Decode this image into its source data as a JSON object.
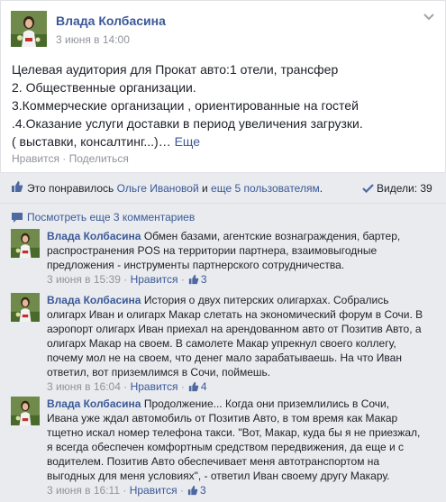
{
  "post": {
    "author": "Влада Колбасина",
    "date": "3 июня в 14:00",
    "body_lines": [
      "Целевая аудитория для Прокат авто:1 отели, трансфер",
      "2. Общественные организации.",
      "3.Коммерческие организации , ориентированные на гостей",
      ".4.Оказание услуги доставки в период увеличения загрузки.",
      "( выставки, консалтинг...)…"
    ],
    "more_label": "Еще",
    "actions": {
      "like": "Нравится",
      "dot": " · ",
      "share": "Поделиться"
    }
  },
  "likes": {
    "prefix": "Это понравилось ",
    "user": "Ольге Ивановой",
    "and": " и ",
    "others": "еще 5 пользователям",
    "suffix": ".",
    "seen": "Видели: 39"
  },
  "view_more": "Посмотреть еще 3 комментариев",
  "comments": [
    {
      "author": "Влада Колбасина",
      "lines": [
        "Обмен базами, агентские вознаграждения, бартер,",
        "распространения POS на территории партнера, взаимовыгодные",
        "предложения - инструменты партнерского сотрудничества."
      ],
      "date": "3 июня в 15:39",
      "like": "Нравится",
      "likes": "3"
    },
    {
      "author": "Влада Колбасина",
      "lines": [
        "История о двух питерских олигархах. Собрались",
        "олигарх Иван и олигарх Макар слетать на экономический форум в Сочи. В",
        "аэропорт олигарх Иван приехал на арендованном авто от Позитив Авто, а",
        "олигарх Макар на своем. В самолете Макар упрекнул своего коллегу,",
        "почему мол не на своем, что денег мало зарабатываешь. На что Иван",
        "ответил, вот приземлимся в Сочи, поймешь."
      ],
      "date": "3 июня в 16:04",
      "like": "Нравится",
      "likes": "4"
    },
    {
      "author": "Влада Колбасина",
      "lines": [
        "Продолжение... Когда они приземлились в Сочи,",
        "Ивана уже ждал автомобиль от Позитив Авто, в том время как Макар",
        "тщетно искал номер телефона такси. \"Вот, Макар, куда бы я не приезжал,",
        "я всегда обеспечен комфортным средством передвижения, да еще и с",
        "водителем. Позитив Авто обеспечивает меня автотранспортом на",
        "выгодных для меня условиях\", - ответил Иван своему другу Макару."
      ],
      "date": "3 июня в 16:11",
      "like": "Нравится",
      "likes": "3"
    }
  ],
  "colors": {
    "link": "#3b5998",
    "muted": "#90949c",
    "background": "#e9ebee"
  }
}
